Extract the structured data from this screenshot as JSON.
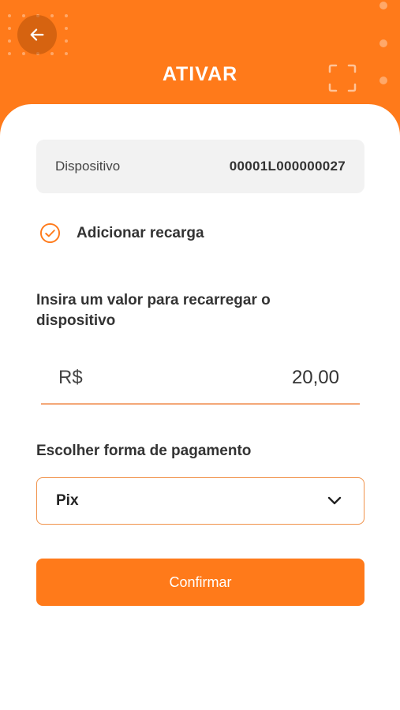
{
  "header": {
    "title": "ATIVAR",
    "back_icon": "arrow-left-icon",
    "scan_icon": "scan-frame-icon"
  },
  "device": {
    "label": "Dispositivo",
    "value": "00001L000000027"
  },
  "recharge": {
    "checked": true,
    "label": "Adicionar recarga"
  },
  "amount": {
    "prompt": "Insira um valor para recarregar o dispositivo",
    "currency": "R$",
    "value": "20,00"
  },
  "payment": {
    "label": "Escolher forma de pagamento",
    "selected": "Pix"
  },
  "actions": {
    "confirm_label": "Confirmar"
  },
  "colors": {
    "brand": "#FF7A1A",
    "accent_border": "#F0924A",
    "card": "#FFFFFF",
    "muted_box": "#F2F2F2"
  }
}
